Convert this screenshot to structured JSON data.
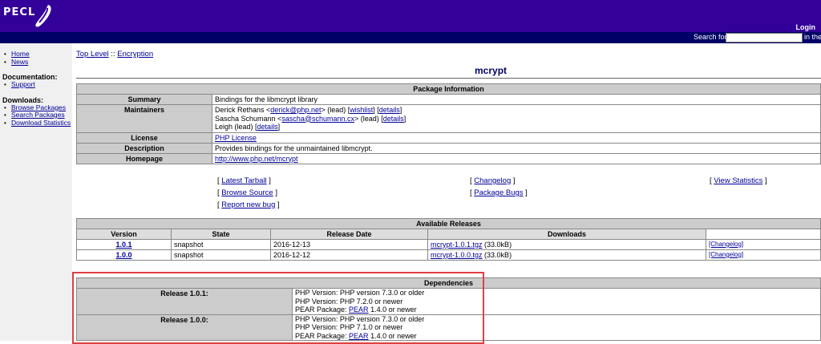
{
  "header": {
    "logo_text": "PECL",
    "login": "Login",
    "search_label": "Search for",
    "search_value": "",
    "search_tail": "in the"
  },
  "sidebar": {
    "top_links": [
      "Home",
      "News"
    ],
    "documentation_heading": "Documentation:",
    "documentation_links": [
      "Support"
    ],
    "downloads_heading": "Downloads:",
    "downloads_links": [
      "Browse Packages",
      "Search Packages",
      "Download Statistics"
    ]
  },
  "breadcrumb": {
    "top": "Top Level",
    "sep": " :: ",
    "current": "Encryption"
  },
  "page_title": "mcrypt",
  "package_info": {
    "heading": "Package Information",
    "summary_label": "Summary",
    "summary": "Bindings for the libmcrypt library",
    "maintainers_label": "Maintainers",
    "maintainers": [
      {
        "name": "Derick Rethans <",
        "email": "derick@php.net",
        "role": "> (lead) [",
        "wishlist": "wishlist",
        "mid": "] [",
        "details": "details",
        "end": "]"
      },
      {
        "name": "Sascha Schumann <",
        "email": "sascha@schumann.cx",
        "role": "> (lead) [",
        "details": "details",
        "end": "]"
      },
      {
        "name": "Leigh (lead) [",
        "details": "details",
        "end": "]"
      }
    ],
    "license_label": "License",
    "license": "PHP License",
    "description_label": "Description",
    "description": "Provides bindings for the unmaintained libmcrypt.",
    "homepage_label": "Homepage",
    "homepage": "http://www.php.net/mcrypt"
  },
  "action_links": {
    "latest_tarball": "Latest Tarball",
    "browse_source": "Browse Source",
    "report_bug": "Report new bug",
    "changelog": "Changelog",
    "package_bugs": "Package Bugs",
    "view_statistics": "View Statistics"
  },
  "releases": {
    "heading": "Available Releases",
    "columns": [
      "Version",
      "State",
      "Release Date",
      "Downloads"
    ],
    "rows": [
      {
        "version": "1.0.1",
        "state": "snapshot",
        "date": "2016-12-13",
        "file": "mcrypt-1.0.1.tgz",
        "size": "(33.0kB)",
        "changelog": "[Changelog]"
      },
      {
        "version": "1.0.0",
        "state": "snapshot",
        "date": "2016-12-12",
        "file": "mcrypt-1.0.0.tgz",
        "size": "(33.0kB)",
        "changelog": "[Changelog]"
      }
    ]
  },
  "dependencies": {
    "heading": "Dependencies",
    "releases": [
      {
        "label": "Release 1.0.1:",
        "lines": [
          "PHP Version: PHP version 7.3.0 or older",
          "PHP Version: PHP 7.2.0 or newer"
        ],
        "pear_prefix": "PEAR Package: ",
        "pear_link": "PEAR",
        "pear_suffix": " 1.4.0 or newer"
      },
      {
        "label": "Release 1.0.0:",
        "lines": [
          "PHP Version: PHP version 7.3.0 or older",
          "PHP Version: PHP 7.1.0 or newer"
        ],
        "pear_prefix": "PEAR Package: ",
        "pear_link": "PEAR",
        "pear_suffix": " 1.4.0 or newer"
      }
    ]
  },
  "colors": {
    "header_bg": "#330099",
    "subbar_bg": "#000066",
    "table_header_bg": "#cccccc",
    "highlight_border": "#e04040"
  }
}
